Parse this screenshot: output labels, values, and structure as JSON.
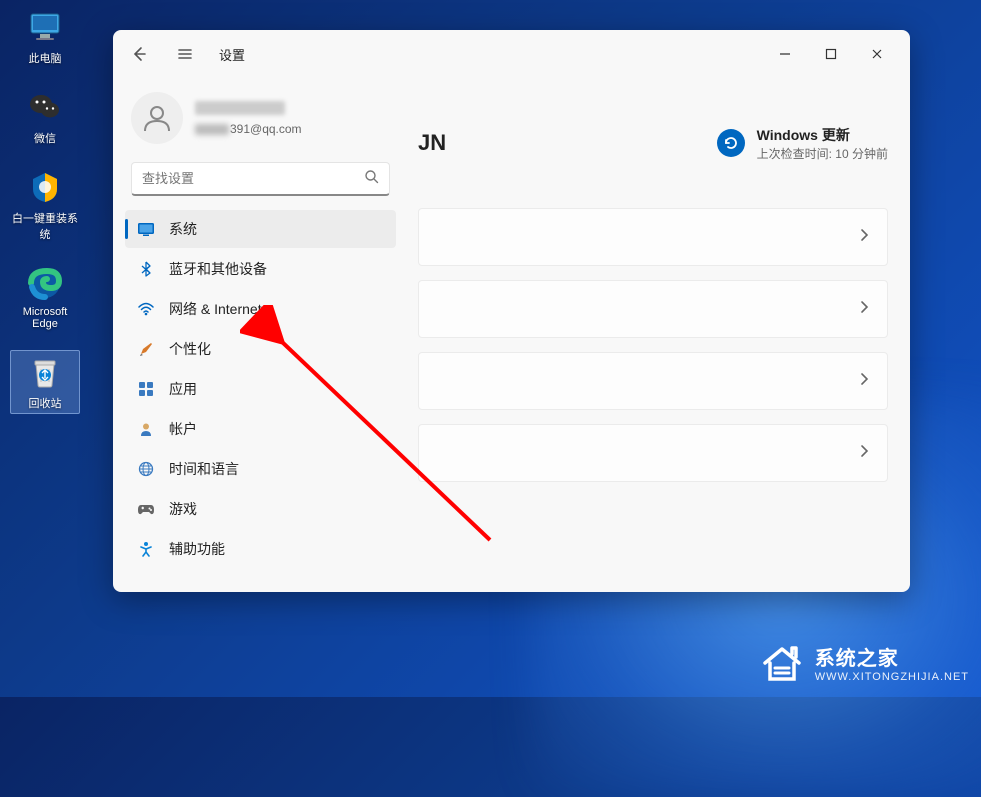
{
  "desktop": {
    "icons": [
      {
        "label": "此电脑",
        "name": "this-pc"
      },
      {
        "label": "微信",
        "name": "wechat"
      },
      {
        "label": "白一键重装系统",
        "name": "reinstall-tool"
      },
      {
        "label": "Microsoft Edge",
        "name": "edge"
      },
      {
        "label": "回收站",
        "name": "recycle-bin"
      }
    ]
  },
  "window": {
    "title": "设置",
    "user": {
      "email_suffix": "391@qq.com"
    },
    "search": {
      "placeholder": "查找设置"
    },
    "nav": [
      {
        "label": "系统",
        "icon": "system",
        "selected": true
      },
      {
        "label": "蓝牙和其他设备",
        "icon": "bluetooth",
        "selected": false
      },
      {
        "label": "网络 & Internet",
        "icon": "network",
        "selected": false
      },
      {
        "label": "个性化",
        "icon": "personalize",
        "selected": false
      },
      {
        "label": "应用",
        "icon": "apps",
        "selected": false
      },
      {
        "label": "帐户",
        "icon": "accounts",
        "selected": false
      },
      {
        "label": "时间和语言",
        "icon": "time-lang",
        "selected": false
      },
      {
        "label": "游戏",
        "icon": "gaming",
        "selected": false
      },
      {
        "label": "辅助功能",
        "icon": "accessibility",
        "selected": false
      }
    ],
    "content": {
      "heading": "JN",
      "update": {
        "title": "Windows 更新",
        "subtitle": "上次检查时间: 10 分钟前"
      },
      "card_count": 4
    }
  },
  "watermark": {
    "line1": "系统之家",
    "line2": "WWW.XITONGZHIJIA.NET"
  }
}
